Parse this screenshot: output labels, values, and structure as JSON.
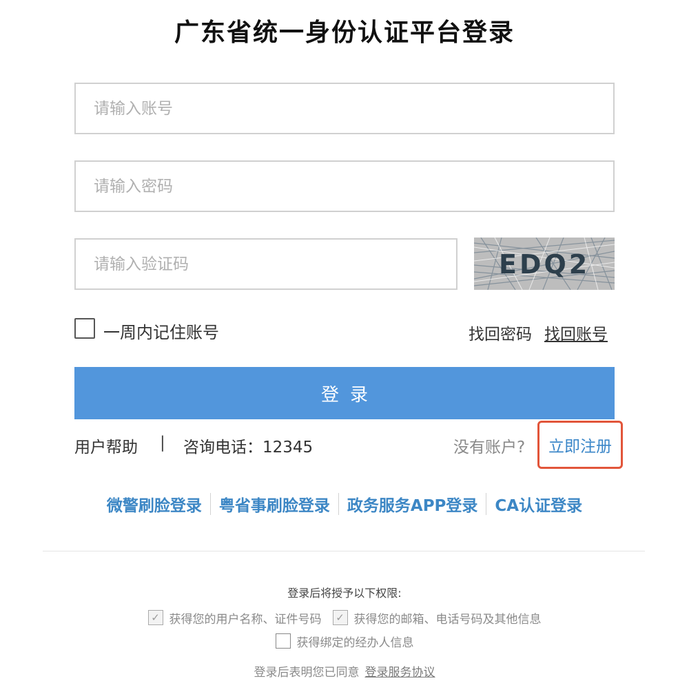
{
  "title": "广东省统一身份认证平台登录",
  "form": {
    "account_placeholder": "请输入账号",
    "password_placeholder": "请输入密码",
    "captcha_placeholder": "请输入验证码",
    "captcha_text": "EDQ2",
    "remember_label": "一周内记住账号",
    "find_password": "找回密码",
    "find_account": "找回账号",
    "login_button": "登录"
  },
  "help": {
    "user_help": "用户帮助",
    "separator": "|",
    "phone": "咨询电话：12345",
    "no_account": "没有账户?",
    "register": "立即注册"
  },
  "alt_logins": [
    {
      "label": "微警刷脸登录"
    },
    {
      "label": "粤省事刷脸登录"
    },
    {
      "label": "政务服务APP登录"
    },
    {
      "label": "CA认证登录"
    }
  ],
  "permissions": {
    "title": "登录后将授予以下权限:",
    "items": [
      {
        "label": "获得您的用户名称、证件号码",
        "checked": true
      },
      {
        "label": "获得您的邮箱、电话号码及其他信息",
        "checked": true
      },
      {
        "label": "获得绑定的经办人信息",
        "checked": false
      }
    ]
  },
  "agreement": {
    "text": "登录后表明您已同意",
    "link": "登录服务协议"
  },
  "colors": {
    "primary": "#5296dc",
    "link": "#3d87c5",
    "highlight_border": "#e2553a"
  }
}
